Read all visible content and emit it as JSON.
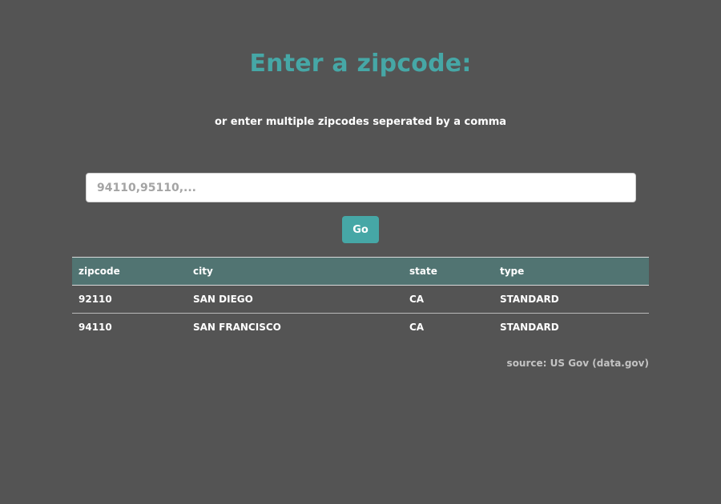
{
  "page": {
    "title": "Enter a zipcode:",
    "subtitle": "or enter multiple zipcodes seperated by a comma"
  },
  "search": {
    "placeholder": "94110,95110,...",
    "value": "",
    "button_label": "Go"
  },
  "table": {
    "headers": [
      "zipcode",
      "city",
      "state",
      "type"
    ],
    "rows": [
      [
        "92110",
        "SAN DIEGO",
        "CA",
        "STANDARD"
      ],
      [
        "94110",
        "SAN FRANCISCO",
        "CA",
        "STANDARD"
      ]
    ]
  },
  "source": "source: US Gov (data.gov)",
  "colors": {
    "background": "#545454",
    "accent": "#46a7a6",
    "table_header": "#517472",
    "text": "#ffffff",
    "muted_text": "#c3c3c3"
  }
}
